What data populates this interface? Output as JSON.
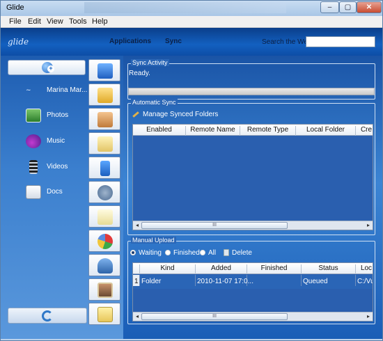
{
  "window": {
    "title": "Glide",
    "controls": {
      "minimize": "‒",
      "maximize": "▢",
      "close": "✕"
    }
  },
  "menu": [
    "File",
    "Edit",
    "View",
    "Tools",
    "Help"
  ],
  "appbar": {
    "logo": "glide",
    "nav": [
      "Applications",
      "Sync"
    ],
    "search_label": "Search the Web",
    "search_value": ""
  },
  "sidebar": {
    "items": [
      {
        "label": "Marina Mar...",
        "icon": "user-signature-icon"
      },
      {
        "label": "Photos",
        "icon": "photos-icon"
      },
      {
        "label": "Music",
        "icon": "music-icon"
      },
      {
        "label": "Videos",
        "icon": "film-icon"
      },
      {
        "label": "Docs",
        "icon": "documents-icon"
      }
    ]
  },
  "toolbar_icons": [
    "desktop-icon",
    "folder-icon",
    "address-book-icon",
    "calendar-icon",
    "notebook-icon",
    "gears-icon",
    "document-edit-icon",
    "pie-chart-icon",
    "bell-icon",
    "photo-frame-icon",
    "note-icon"
  ],
  "sync_activity": {
    "title": "Sync Activity",
    "status": "Ready."
  },
  "automatic_sync": {
    "title": "Automatic Sync",
    "manage_label": "Manage Synced Folders",
    "columns": [
      "Enabled",
      "Remote Name",
      "Remote Type",
      "Local Folder",
      "Cre"
    ],
    "scroll_grip": "III"
  },
  "manual_upload": {
    "title": "Manual Upload",
    "filters": [
      {
        "label": "Waiting",
        "selected": true
      },
      {
        "label": "Finished",
        "selected": false
      },
      {
        "label": "All",
        "selected": false
      }
    ],
    "delete_label": "Delete",
    "columns": [
      "Kind",
      "Added",
      "Finished",
      "Status",
      "Loc"
    ],
    "rows": [
      {
        "index": "1",
        "kind": "Folder",
        "added": "2010-11-07 17:0...",
        "finished": "",
        "status": "Queued",
        "location": "C:/Vue"
      }
    ],
    "scroll_grip": "III"
  }
}
